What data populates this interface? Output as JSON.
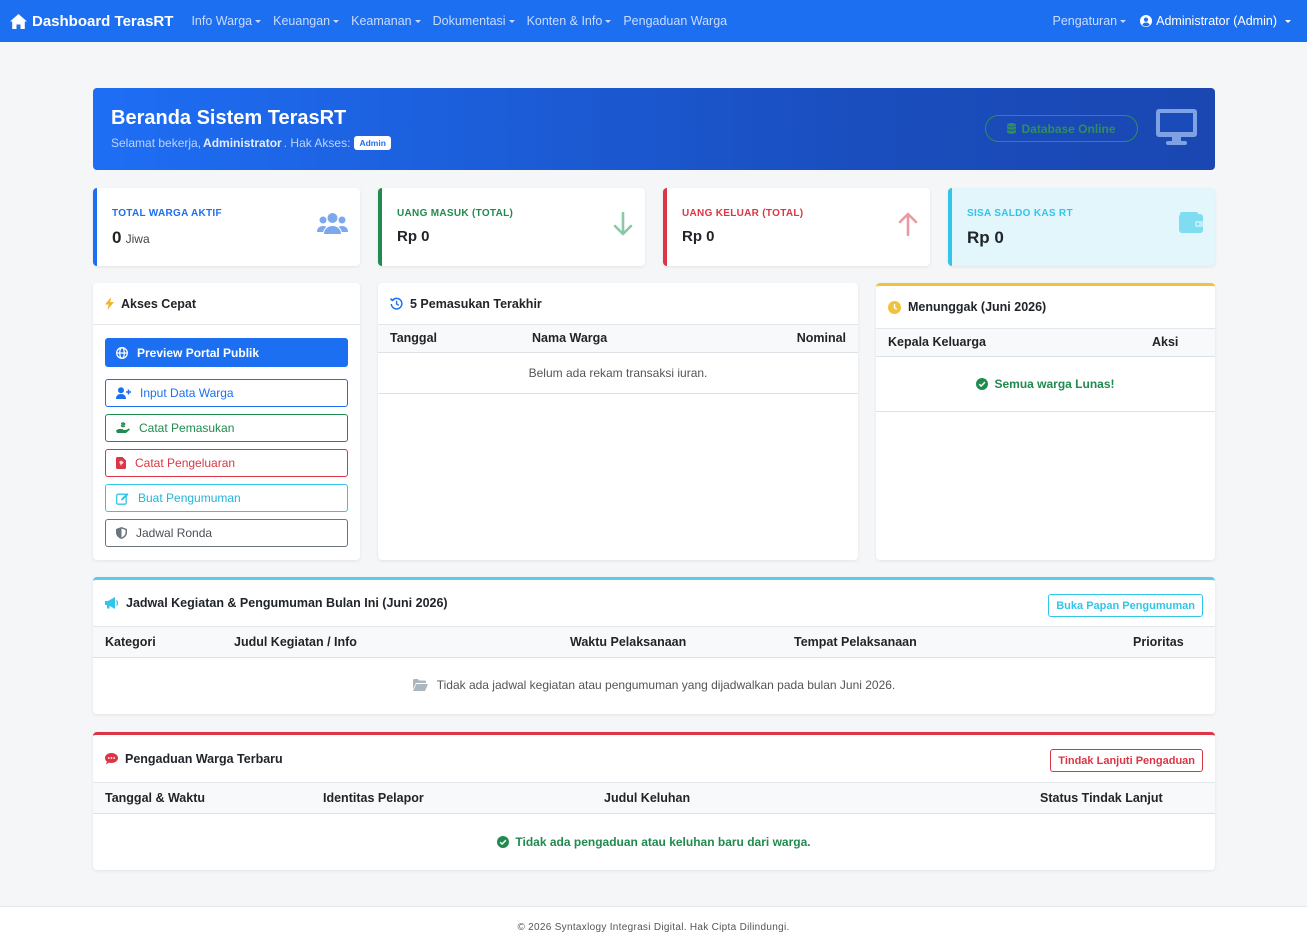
{
  "nav": {
    "brand": "Dashboard TerasRT",
    "items": [
      "Info Warga",
      "Keuangan",
      "Keamanan",
      "Dokumentasi",
      "Konten & Info"
    ],
    "plain_item": "Pengaduan Warga",
    "settings": "Pengaturan",
    "user": "Administrator (Admin)"
  },
  "hero": {
    "title": "Beranda Sistem TerasRT",
    "greeting": "Selamat bekerja,",
    "user": "Administrator",
    "access_label": ". Hak Akses:",
    "role_badge": "Admin",
    "db_status": "Database Online"
  },
  "stats": [
    {
      "label": "TOTAL WARGA AKTIF",
      "value": "0",
      "unit": "Jiwa",
      "color": "#1d6ff2",
      "icon": "users-icon"
    },
    {
      "label": "UANG MASUK (TOTAL)",
      "value": "Rp 0",
      "color": "#208a4f",
      "icon": "arrow-down-icon"
    },
    {
      "label": "UANG KELUAR (TOTAL)",
      "value": "Rp 0",
      "color": "#dc3545",
      "icon": "arrow-up-icon"
    },
    {
      "label": "SISA SALDO KAS RT",
      "value": "Rp 0",
      "color": "#32c5e9",
      "icon": "wallet-icon"
    }
  ],
  "quick": {
    "title": "Akses Cepat",
    "buttons": [
      "Preview Portal Publik",
      "Input Data Warga",
      "Catat Pemasukan",
      "Catat Pengeluaran",
      "Buat Pengumuman",
      "Jadwal Ronda"
    ]
  },
  "income": {
    "title": "5 Pemasukan Terakhir",
    "columns": [
      "Tanggal",
      "Nama Warga",
      "Nominal"
    ],
    "empty": "Belum ada rekam transaksi iuran."
  },
  "arrears": {
    "title": "Menunggak (Juni 2026)",
    "columns": [
      "Kepala Keluarga",
      "Aksi"
    ],
    "empty": "Semua warga Lunas!"
  },
  "schedule": {
    "title": "Jadwal Kegiatan & Pengumuman Bulan Ini (Juni 2026)",
    "button": "Buka Papan Pengumuman",
    "columns": [
      "Kategori",
      "Judul Kegiatan / Info",
      "Waktu Pelaksanaan",
      "Tempat Pelaksanaan",
      "Prioritas"
    ],
    "empty": "Tidak ada jadwal kegiatan atau pengumuman yang dijadwalkan pada bulan Juni 2026."
  },
  "complaints": {
    "title": "Pengaduan Warga Terbaru",
    "button": "Tindak Lanjuti Pengaduan",
    "columns": [
      "Tanggal & Waktu",
      "Identitas Pelapor",
      "Judul Keluhan",
      "Status Tindak Lanjut"
    ],
    "empty": "Tidak ada pengaduan atau keluhan baru dari warga."
  },
  "footer": "© 2026 Syntaxlogy Integrasi Digital. Hak Cipta Dilindungi."
}
